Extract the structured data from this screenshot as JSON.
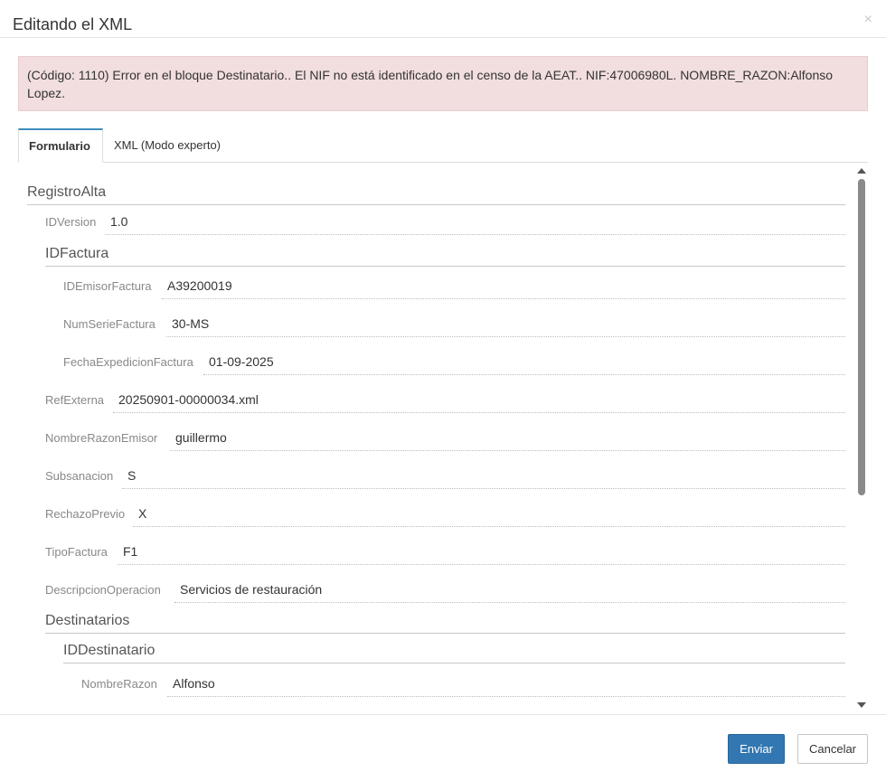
{
  "modal": {
    "title": "Editando el XML",
    "close_glyph": "×"
  },
  "alert": {
    "text": "(Código: 1110) Error en el bloque Destinatario.. El NIF no está identificado en el censo de la AEAT.. NIF:47006980L. NOMBRE_RAZON:Alfonso Lopez."
  },
  "tabs": [
    {
      "label": "Formulario",
      "active": true
    },
    {
      "label": "XML (Modo experto)",
      "active": false
    }
  ],
  "form": {
    "registro_alta": "RegistroAlta",
    "id_version": {
      "label": "IDVersion",
      "value": "1.0"
    },
    "id_factura": "IDFactura",
    "id_emisor_factura": {
      "label": "IDEmisorFactura",
      "value": "A39200019"
    },
    "num_serie_factura": {
      "label": "NumSerieFactura",
      "value": "30-MS"
    },
    "fecha_expedicion_factura": {
      "label": "FechaExpedicionFactura",
      "value": "01-09-2025"
    },
    "ref_externa": {
      "label": "RefExterna",
      "value": "20250901-00000034.xml"
    },
    "nombre_razon_emisor": {
      "label": "NombreRazonEmisor",
      "value": "guillermo"
    },
    "subsanacion": {
      "label": "Subsanacion",
      "value": "S"
    },
    "rechazo_previo": {
      "label": "RechazoPrevio",
      "value": "X"
    },
    "tipo_factura": {
      "label": "TipoFactura",
      "value": "F1"
    },
    "descripcion_operacion": {
      "label": "DescripcionOperacion",
      "value": "Servicios de restauración"
    },
    "destinatarios": "Destinatarios",
    "id_destinatario": "IDDestinatario",
    "nombre_razon": {
      "label": "NombreRazon",
      "value": "Alfonso"
    }
  },
  "footer": {
    "send_label": "Enviar",
    "cancel_label": "Cancelar"
  },
  "colors": {
    "primary": "#3277b2",
    "alert_bg": "#f2dede",
    "tab_accent": "#3c8dbc"
  }
}
